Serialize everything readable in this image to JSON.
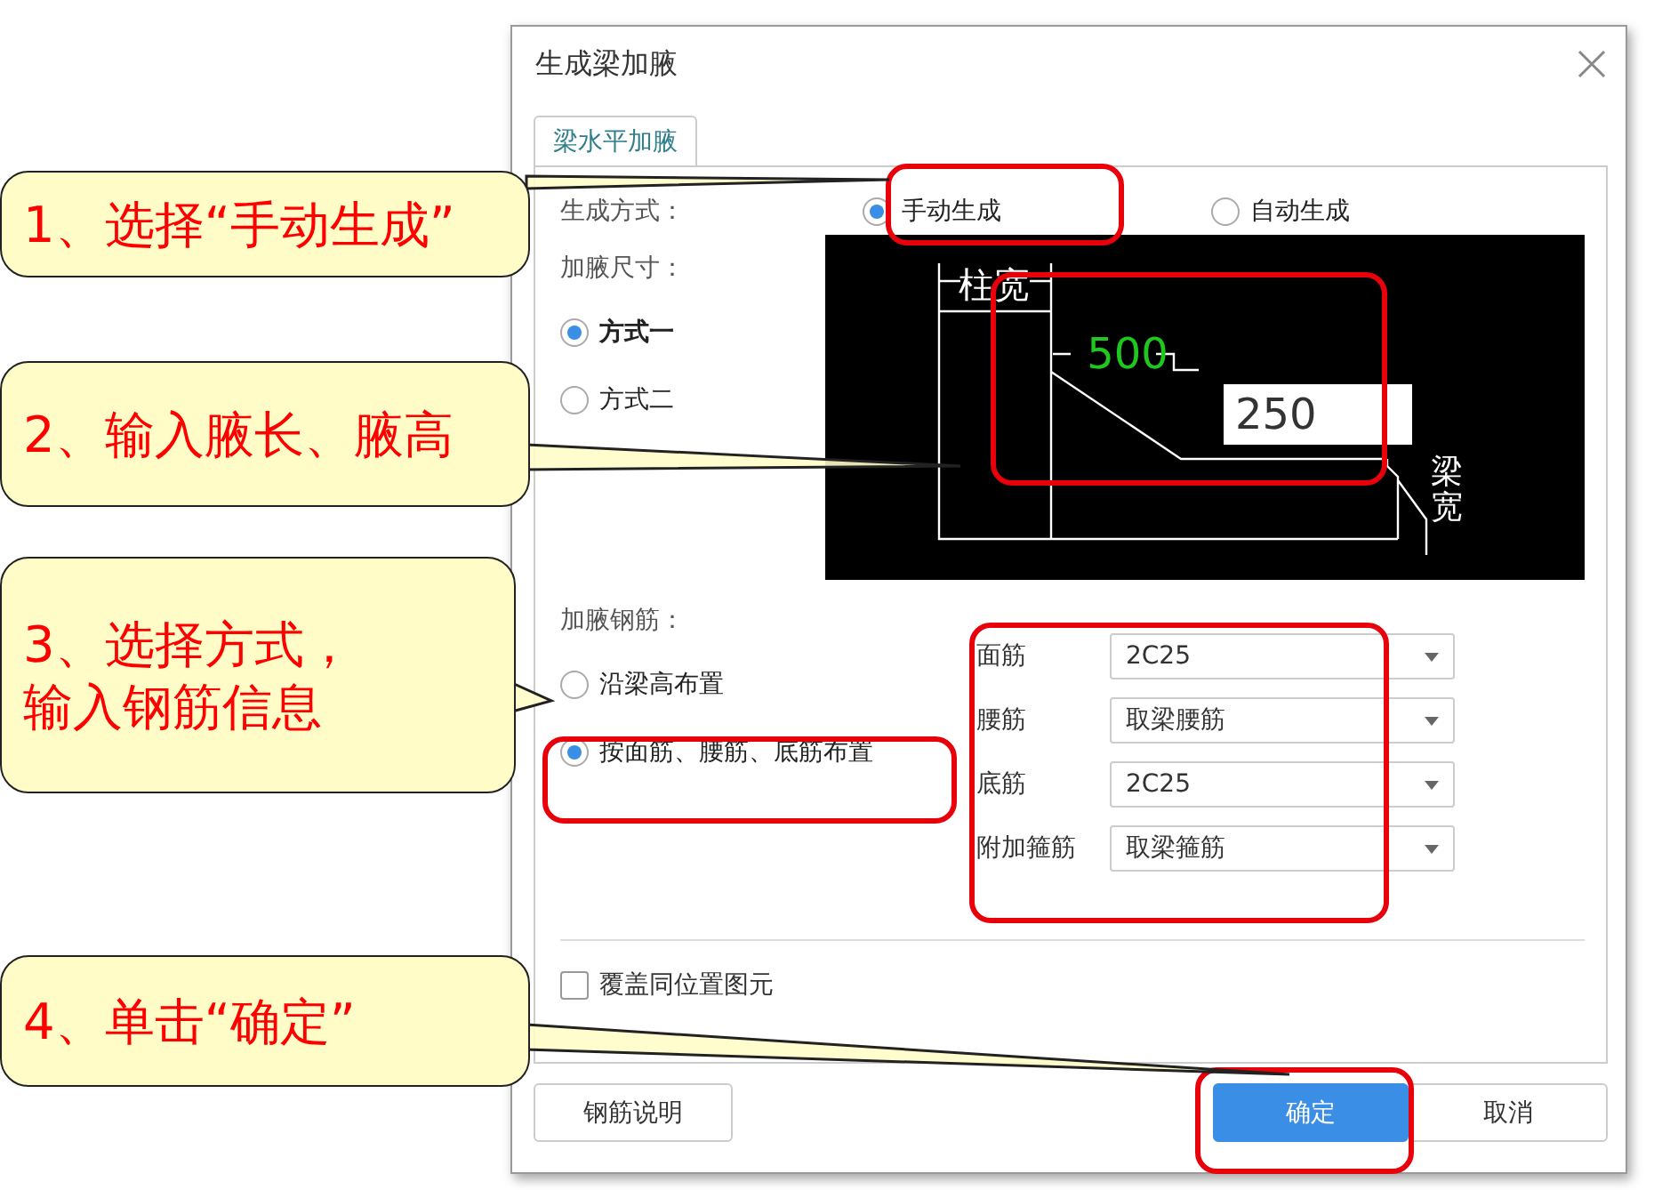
{
  "dialog": {
    "title": "生成梁加腋",
    "tabs": [
      {
        "label": "梁水平加腋",
        "selected": true
      }
    ],
    "generation": {
      "label": "生成方式：",
      "options": [
        {
          "label": "手动生成",
          "selected": true
        },
        {
          "label": "自动生成",
          "selected": false
        }
      ]
    },
    "size": {
      "label": "加腋尺寸：",
      "options": [
        {
          "label": "方式一",
          "selected": true
        },
        {
          "label": "方式二",
          "selected": false
        }
      ]
    },
    "diagram": {
      "column_width_label": "柱宽",
      "length_value": "500",
      "height_value": "250",
      "beam_width_label": "梁宽"
    },
    "rebar": {
      "label": "加腋钢筋：",
      "options": [
        {
          "label": "沿梁高布置",
          "selected": false
        },
        {
          "label": "按面筋、腰筋、底筋布置",
          "selected": true
        }
      ],
      "fields": [
        {
          "label": "面筋",
          "value": "2C25"
        },
        {
          "label": "腰筋",
          "value": "取梁腰筋"
        },
        {
          "label": "底筋",
          "value": "2C25"
        },
        {
          "label": "附加箍筋",
          "value": "取梁箍筋"
        }
      ]
    },
    "overwrite": {
      "label": "覆盖同位置图元",
      "checked": false
    },
    "buttons": [
      {
        "label": "钢筋说明",
        "kind": "default"
      },
      {
        "label": "确定",
        "kind": "primary"
      },
      {
        "label": "取消",
        "kind": "default"
      }
    ]
  },
  "callouts": [
    {
      "lines": [
        "1、选择“手动生成”"
      ]
    },
    {
      "lines": [
        "2、输入腋长、腋高"
      ]
    },
    {
      "lines": [
        "3、选择方式，",
        "输入钢筋信息"
      ]
    },
    {
      "lines": [
        "4、单击“确定”"
      ]
    }
  ]
}
